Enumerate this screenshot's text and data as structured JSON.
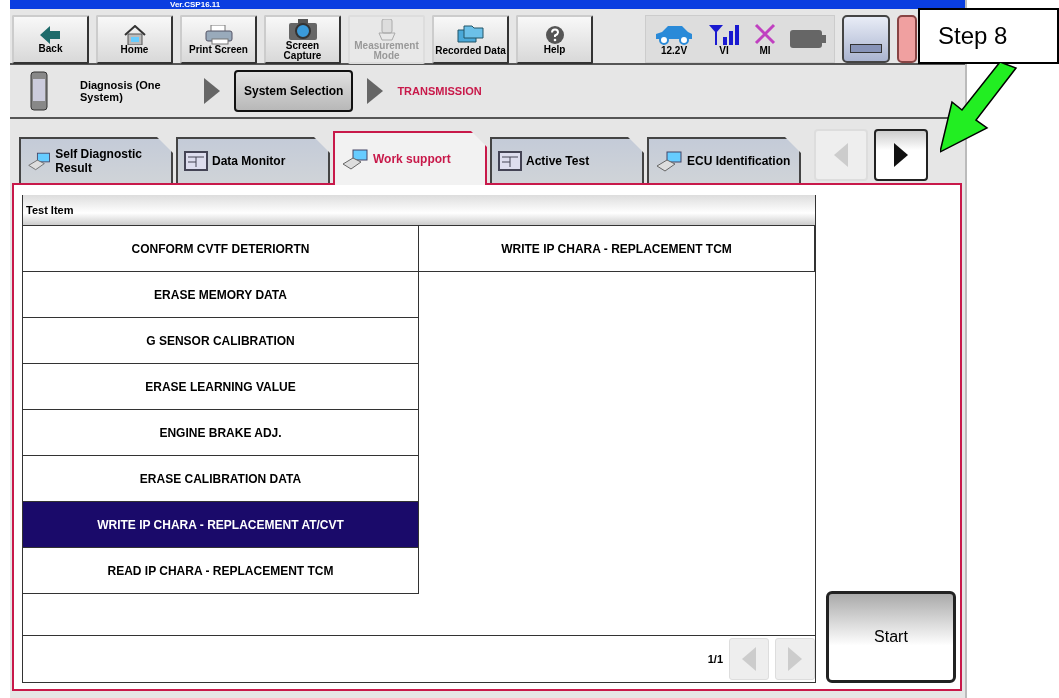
{
  "title_bar": {
    "title": "Ver.CSP16.11"
  },
  "toolbar": {
    "buttons": [
      {
        "label": "Back",
        "kind": "back",
        "disabled": false
      },
      {
        "label": "Home",
        "kind": "home",
        "disabled": false
      },
      {
        "label": "Print Screen",
        "kind": "print",
        "disabled": false
      },
      {
        "label": "Screen Capture",
        "kind": "capture",
        "disabled": false
      },
      {
        "label": "Measurement Mode",
        "kind": "measure",
        "disabled": true
      },
      {
        "label": "Recorded Data",
        "kind": "recorded",
        "disabled": false
      },
      {
        "label": "Help",
        "kind": "help",
        "disabled": false
      }
    ],
    "status": [
      {
        "kind": "car",
        "label": "12.2V"
      },
      {
        "kind": "signal",
        "label": "VI"
      },
      {
        "kind": "cross",
        "label": "MI"
      },
      {
        "kind": "battery"
      }
    ]
  },
  "breadcrumb": [
    {
      "kind": "device",
      "label": "Diagnosis (One System)"
    },
    {
      "kind": "button",
      "label": "System Selection"
    },
    {
      "kind": "current",
      "label": "TRANSMISSION"
    }
  ],
  "tabs": [
    {
      "label": "Self Diagnostic Result",
      "selected": false
    },
    {
      "label": "Data Monitor",
      "selected": false
    },
    {
      "label": "Work support",
      "selected": true
    },
    {
      "label": "Active Test",
      "selected": false
    },
    {
      "label": "ECU Identification",
      "selected": false
    }
  ],
  "tab_nav": {
    "previous_disabled": true,
    "next_disabled": false
  },
  "table": {
    "header": "Test Item",
    "column_1": [
      {
        "label": "CONFORM CVTF DETERIORTN",
        "selected": false
      },
      {
        "label": "ERASE MEMORY DATA",
        "selected": false
      },
      {
        "label": "G SENSOR CALIBRATION",
        "selected": false
      },
      {
        "label": "ERASE LEARNING VALUE",
        "selected": false
      },
      {
        "label": "ENGINE BRAKE ADJ.",
        "selected": false
      },
      {
        "label": "ERASE CALIBRATION DATA",
        "selected": false
      },
      {
        "label": "WRITE IP CHARA - REPLACEMENT AT/CVT",
        "selected": true
      },
      {
        "label": "READ IP CHARA - REPLACEMENT TCM",
        "selected": false
      }
    ],
    "column_2": [
      {
        "label": "WRITE IP CHARA - REPLACEMENT TCM",
        "selected": false
      }
    ]
  },
  "pager": {
    "label": "1/1",
    "previous_disabled": true,
    "next_disabled": true
  },
  "start_button": "Start",
  "callout": {
    "label": "Step 8"
  }
}
